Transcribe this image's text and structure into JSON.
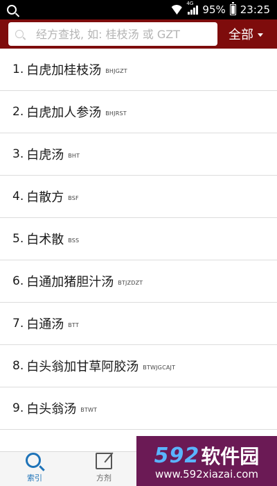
{
  "status_bar": {
    "battery": "95%",
    "time": "23:25",
    "network": "4G"
  },
  "search": {
    "placeholder": "经方查找, 如: 桂枝汤 或 GZT"
  },
  "filter": {
    "label": "全部"
  },
  "items": [
    {
      "index": "1.",
      "name": "白虎加桂枝汤",
      "abbr": "BHJGZT"
    },
    {
      "index": "2.",
      "name": "白虎加人参汤",
      "abbr": "BHJRST"
    },
    {
      "index": "3.",
      "name": "白虎汤",
      "abbr": "BHT"
    },
    {
      "index": "4.",
      "name": "白散方",
      "abbr": "BSF"
    },
    {
      "index": "5.",
      "name": "白术散",
      "abbr": "BSS"
    },
    {
      "index": "6.",
      "name": "白通加猪胆汁汤",
      "abbr": "BTJZDZT"
    },
    {
      "index": "7.",
      "name": "白通汤",
      "abbr": "BTT"
    },
    {
      "index": "8.",
      "name": "白头翁加甘草阿胶汤",
      "abbr": "BTWJGCAJT"
    },
    {
      "index": "9.",
      "name": "白头翁汤",
      "abbr": "BTWT"
    }
  ],
  "tabs": [
    {
      "label": "索引",
      "icon": "search-icon",
      "active": true
    },
    {
      "label": "方剂",
      "icon": "edit-icon",
      "active": false
    }
  ],
  "watermark": {
    "num": "592",
    "cn": "软件园",
    "url": "www.592xiazai.com"
  },
  "colors": {
    "topbar": "#7e0c0c",
    "active_tab": "#1e73b8"
  }
}
